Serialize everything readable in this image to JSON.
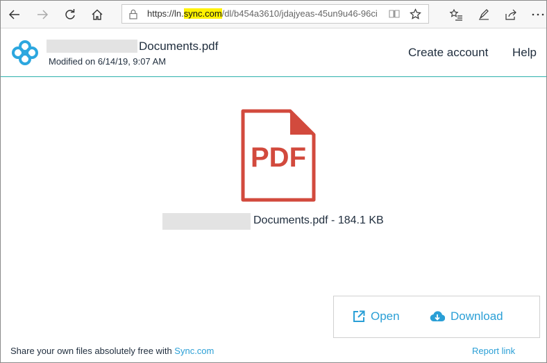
{
  "browser": {
    "url_prefix": "https://ln.",
    "url_highlight": "sync.com",
    "url_rest": "/dl/b454a3610/jdajyeas-45un9u46-96ci",
    "back_icon": "back-arrow-icon",
    "forward_icon": "forward-arrow-icon",
    "refresh_icon": "refresh-icon",
    "home_icon": "home-icon"
  },
  "header": {
    "file_name": "Documents.pdf",
    "modified": "Modified on 6/14/19, 9:07 AM",
    "create_account": "Create account",
    "help": "Help",
    "brand_color": "#2ca7df"
  },
  "main": {
    "pdf_icon_label": "PDF",
    "pdf_icon_color": "#d24a3d",
    "file_info": "Documents.pdf - 184.1 KB",
    "open_label": "Open",
    "download_label": "Download"
  },
  "footer": {
    "share_text": "Share your own files absolutely free with ",
    "share_link": "Sync.com",
    "report_link": "Report link"
  }
}
